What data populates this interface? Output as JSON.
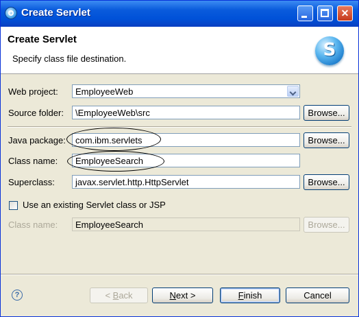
{
  "window": {
    "title": "Create Servlet",
    "minimize_icon": "minimize-icon",
    "maximize_icon": "maximize-icon",
    "close_icon": "close-icon"
  },
  "header": {
    "title": "Create Servlet",
    "description": "Specify class file destination.",
    "icon": "servlet-wizard-icon"
  },
  "form": {
    "web_project": {
      "label": "Web project:",
      "value": "EmployeeWeb"
    },
    "source_folder": {
      "label": "Source folder:",
      "value": "\\EmployeeWeb\\src",
      "browse": "Browse..."
    },
    "java_package": {
      "label": "Java package:",
      "value": "com.ibm.servlets",
      "browse": "Browse..."
    },
    "class_name": {
      "label": "Class name:",
      "value": "EmployeeSearch"
    },
    "superclass": {
      "label": "Superclass:",
      "value": "javax.servlet.http.HttpServlet",
      "browse": "Browse..."
    },
    "use_existing": {
      "label": "Use an existing Servlet class or JSP",
      "checked": false
    },
    "existing_class_name": {
      "label": "Class name:",
      "value": "EmployeeSearch",
      "browse": "Browse..."
    }
  },
  "footer": {
    "help_icon": "help-icon",
    "back_pre": "< ",
    "back_key": "B",
    "back_post": "ack",
    "next_key": "N",
    "next_post": "ext >",
    "finish_key": "F",
    "finish_post": "inish",
    "cancel": "Cancel"
  },
  "colors": {
    "titlebar": "#0A5BDC",
    "dialog_bg": "#ECE9D8",
    "header_bg": "#FFFFFF"
  }
}
